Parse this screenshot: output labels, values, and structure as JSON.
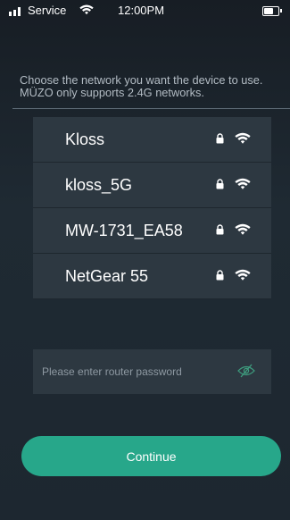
{
  "status_bar": {
    "carrier": "Service",
    "time": "12:00PM",
    "battery_level": 0.75
  },
  "instruction": "Choose the network you want the device to use. MÜZO only supports 2.4G networks.",
  "networks": [
    {
      "name": "Kloss",
      "icons": [
        "lock-icon",
        "wifi-icon"
      ]
    },
    {
      "name": "kloss_5G",
      "icons": [
        "lock-icon",
        "wifi-icon"
      ]
    },
    {
      "name": "MW-1731_EA58",
      "icons": [
        "lock-icon",
        "wifi-icon"
      ]
    },
    {
      "name": "NetGear 55",
      "icons": [
        "lock-icon",
        "wifi-icon"
      ]
    }
  ],
  "password": {
    "value": "",
    "placeholder": "Please enter router password",
    "visibility_icon": "eye-slash-icon"
  },
  "continue_label": "Continue",
  "colors": {
    "accent": "#27a78a",
    "background": "#1f2a33",
    "list_item": "#2d3841",
    "instruction_text": "#b3bcc4"
  }
}
